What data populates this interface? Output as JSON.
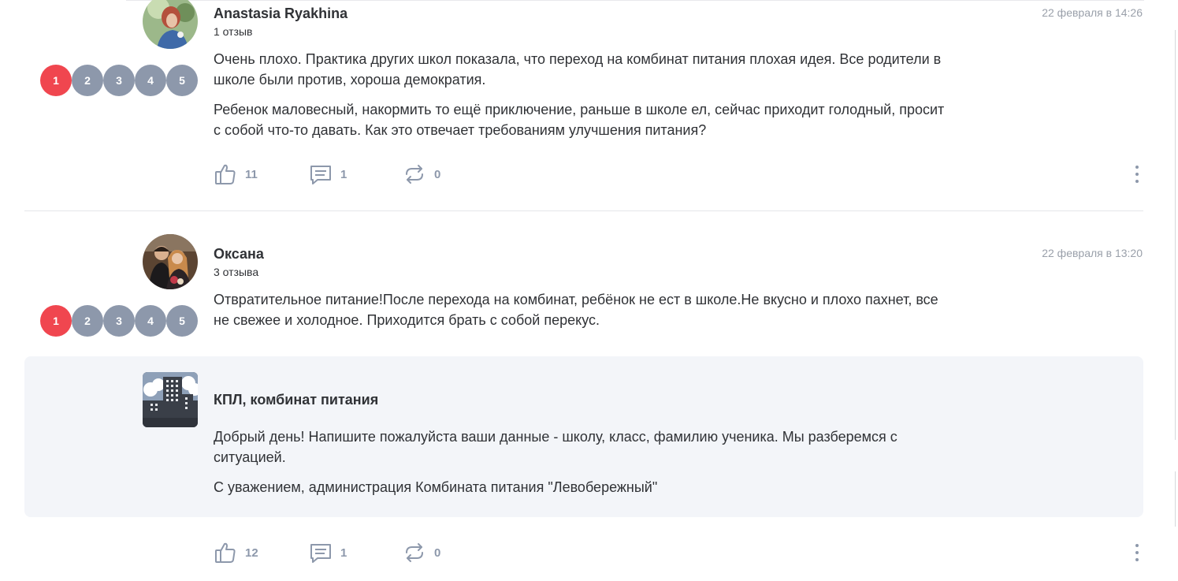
{
  "reviews": [
    {
      "author": "Anastasia Ryakhina",
      "review_count": "1 отзыв",
      "date": "22 февраля в 14:26",
      "rating_options": [
        "1",
        "2",
        "3",
        "4",
        "5"
      ],
      "rating": 1,
      "paragraphs": [
        "Очень плохо. Практика других школ показала, что переход на комбинат питания плохая идея. Все родители в школе были против, хороша демократия.",
        "Ребенок маловесный, накормить то ещё приключение, раньше в школе ел, сейчас приходит голодный, просит с собой что-то давать. Как это отвечает требованиям улучшения питания?"
      ],
      "likes": "11",
      "comments": "1",
      "reposts": "0"
    },
    {
      "author": "Оксана",
      "review_count": "3 отзыва",
      "date": "22 февраля в 13:20",
      "rating_options": [
        "1",
        "2",
        "3",
        "4",
        "5"
      ],
      "rating": 1,
      "paragraphs": [
        "Отвратительное питание!После перехода на комбинат, ребёнок не ест в школе.Не вкусно и плохо пахнет, все не свежее и холодное. Приходится брать с собой перекус."
      ],
      "reply": {
        "author": "КПЛ, комбинат питания",
        "paragraphs": [
          "Добрый день! Напишите пожалуйста ваши данные - школу, класс, фамилию ученика. Мы разберемся с ситуацией.",
          "С уважением, администрация Комбината питания \"Левобережный\""
        ]
      },
      "likes": "12",
      "comments": "1",
      "reposts": "0"
    }
  ],
  "icons": {
    "like": "thumbs-up-icon",
    "comment": "comment-icon",
    "repost": "repost-icon",
    "more": "more-vertical-icon"
  },
  "colors": {
    "rating_active": "#f0464f",
    "rating_inactive": "#8d98ab",
    "reply_background": "#f3f5f9",
    "muted_text": "#9aa0aa"
  }
}
